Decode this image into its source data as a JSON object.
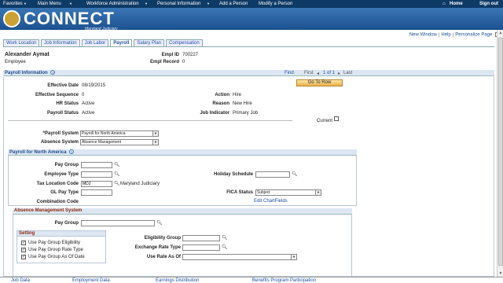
{
  "nav": {
    "favorites": "Favorites",
    "main_menu": "Main Menu",
    "workforce": "Workforce Administration",
    "personal": "Personal Information",
    "add_person": "Add a Person",
    "modify_person": "Modify a Person",
    "home": "Home",
    "sign_out": "Sign out"
  },
  "brand": {
    "name": "CONNECT",
    "sub": "Maryland Judiciary"
  },
  "links": {
    "new_window": "New Window",
    "help": "Help",
    "personalize": "Personalize Page"
  },
  "tabs": [
    "Work Location",
    "Job Information",
    "Job Labor",
    "Payroll",
    "Salary Plan",
    "Compensation"
  ],
  "employee": {
    "name": "Alexander Aymat",
    "type": "Employee",
    "empl_id_label": "Empl ID",
    "empl_id": "700227",
    "empl_record_label": "Empl Record",
    "empl_record": "0"
  },
  "payroll_info": {
    "title": "Payroll Information",
    "find": "Find",
    "first": "First",
    "count": "1 of 1",
    "last": "Last",
    "go_to_row": "Go To Row",
    "effective_date_label": "Effective Date",
    "effective_date": "08/19/2015",
    "effective_sequence_label": "Effective Sequence",
    "effective_sequence": "0",
    "hr_status_label": "HR Status",
    "hr_status": "Active",
    "payroll_status_label": "Payroll Status",
    "payroll_status": "Active",
    "action_label": "Action",
    "action": "Hire",
    "reason_label": "Reason",
    "reason": "New Hire",
    "job_indicator_label": "Job Indicator",
    "job_indicator": "Primary Job",
    "current_label": "Current",
    "payroll_system_label": "*Payroll System",
    "payroll_system": "Payroll for North America",
    "absence_system_label": "Absence System",
    "absence_system": "Absence Management"
  },
  "pna": {
    "title": "Payroll for North America",
    "pay_group_label": "Pay Group",
    "employee_type_label": "Employee Type",
    "tax_location_label": "Tax Location Code",
    "tax_location": "MDJ",
    "tax_location_desc": "Maryland Judiciary",
    "gl_pay_type_label": "GL Pay Type",
    "combination_code_label": "Combination Code",
    "holiday_schedule_label": "Holiday Schedule",
    "fica_status_label": "FICA Status",
    "fica_status": "Subject",
    "edit_chartfields": "Edit ChartFields"
  },
  "ams": {
    "title": "Absence Management System",
    "pay_group_label": "Pay Group",
    "setting_title": "Setting",
    "use_pg_eligibility": "Use Pay Group Eligibility",
    "use_pg_rate_type": "Use Pay Group Rate Type",
    "use_pg_as_of_date": "Use Pay Group As Of Date",
    "eligibility_group_label": "Eligibility Group",
    "exchange_rate_type_label": "Exchange Rate Type",
    "use_rate_as_of_label": "Use Rate As Of"
  },
  "bottom_links": [
    "Job Data",
    "Employment Data",
    "Earnings Distribution",
    "Benefits Program Participation"
  ]
}
